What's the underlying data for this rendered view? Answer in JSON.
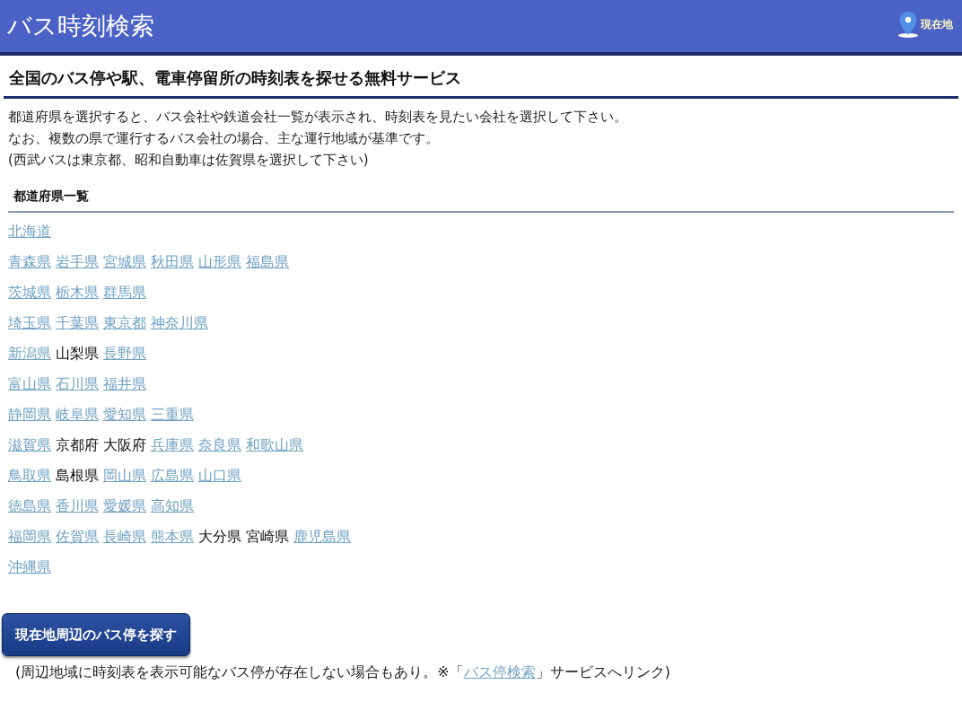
{
  "header": {
    "title": "バス時刻検索",
    "location_link": "現在地"
  },
  "heading": "全国のバス停や駅、電車停留所の時刻表を探せる無料サービス",
  "intro": [
    "都道府県を選択すると、バス会社や鉄道会社一覧が表示され、時刻表を見たい会社を選択して下さい。",
    "なお、複数の県で運行するバス会社の場合、主な運行地域が基準です。",
    "(西武バスは東京都、昭和自動車は佐賀県を選択して下さい)"
  ],
  "prefecture_list": {
    "title": "都道府県一覧",
    "rows": [
      [
        {
          "name": "北海道",
          "link": true
        }
      ],
      [
        {
          "name": "青森県",
          "link": true
        },
        {
          "name": "岩手県",
          "link": true
        },
        {
          "name": "宮城県",
          "link": true
        },
        {
          "name": "秋田県",
          "link": true
        },
        {
          "name": "山形県",
          "link": true
        },
        {
          "name": "福島県",
          "link": true
        }
      ],
      [
        {
          "name": "茨城県",
          "link": true
        },
        {
          "name": "栃木県",
          "link": true
        },
        {
          "name": "群馬県",
          "link": true
        }
      ],
      [
        {
          "name": "埼玉県",
          "link": true
        },
        {
          "name": "千葉県",
          "link": true
        },
        {
          "name": "東京都",
          "link": true
        },
        {
          "name": "神奈川県",
          "link": true
        }
      ],
      [
        {
          "name": "新潟県",
          "link": true
        },
        {
          "name": "山梨県",
          "link": false
        },
        {
          "name": "長野県",
          "link": true
        }
      ],
      [
        {
          "name": "富山県",
          "link": true
        },
        {
          "name": "石川県",
          "link": true
        },
        {
          "name": "福井県",
          "link": true
        }
      ],
      [
        {
          "name": "静岡県",
          "link": true
        },
        {
          "name": "岐阜県",
          "link": true
        },
        {
          "name": "愛知県",
          "link": true
        },
        {
          "name": "三重県",
          "link": true
        }
      ],
      [
        {
          "name": "滋賀県",
          "link": true
        },
        {
          "name": "京都府",
          "link": false
        },
        {
          "name": "大阪府",
          "link": false
        },
        {
          "name": "兵庫県",
          "link": true
        },
        {
          "name": "奈良県",
          "link": true
        },
        {
          "name": "和歌山県",
          "link": true
        }
      ],
      [
        {
          "name": "鳥取県",
          "link": true
        },
        {
          "name": "島根県",
          "link": false
        },
        {
          "name": "岡山県",
          "link": true
        },
        {
          "name": "広島県",
          "link": true
        },
        {
          "name": "山口県",
          "link": true
        }
      ],
      [
        {
          "name": "徳島県",
          "link": true
        },
        {
          "name": "香川県",
          "link": true
        },
        {
          "name": "愛媛県",
          "link": true
        },
        {
          "name": "高知県",
          "link": true
        }
      ],
      [
        {
          "name": "福岡県",
          "link": true
        },
        {
          "name": "佐賀県",
          "link": true
        },
        {
          "name": "長崎県",
          "link": true
        },
        {
          "name": "熊本県",
          "link": true
        },
        {
          "name": "大分県",
          "link": false
        },
        {
          "name": "宮崎県",
          "link": false
        },
        {
          "name": "鹿児島県",
          "link": true
        }
      ],
      [
        {
          "name": "沖縄県",
          "link": true
        }
      ]
    ]
  },
  "nearby_button": "現在地周辺のバス停を探す",
  "note": {
    "before": "(周辺地域に時刻表を表示可能なバス停が存在しない場合もあり。※「",
    "link": "バス停検索",
    "after": "」サービスへリンク)"
  }
}
